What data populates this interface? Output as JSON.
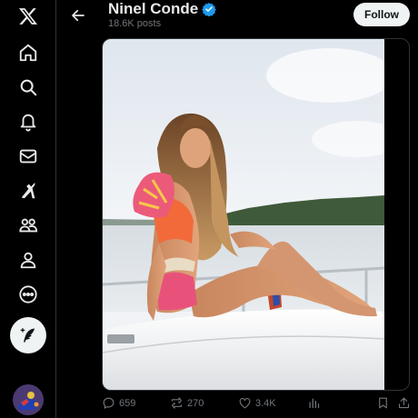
{
  "nav": {
    "items": [
      {
        "icon": "x-logo-icon"
      },
      {
        "icon": "home-icon"
      },
      {
        "icon": "search-icon"
      },
      {
        "icon": "notifications-icon"
      },
      {
        "icon": "messages-icon"
      },
      {
        "icon": "grok-icon"
      },
      {
        "icon": "communities-icon"
      },
      {
        "icon": "profile-icon"
      },
      {
        "icon": "more-icon"
      }
    ],
    "post_icon": "compose-icon"
  },
  "header": {
    "name": "Ninel Conde",
    "posts_count": "18.6K posts",
    "follow_label": "Follow"
  },
  "actions": {
    "replies": "659",
    "reposts": "270",
    "likes": "3.4K"
  },
  "colors": {
    "background": "#000000",
    "text": "#e7e9ea",
    "muted": "#71767b",
    "verified": "#1d9bf0",
    "follow_bg": "#eff3f4"
  }
}
